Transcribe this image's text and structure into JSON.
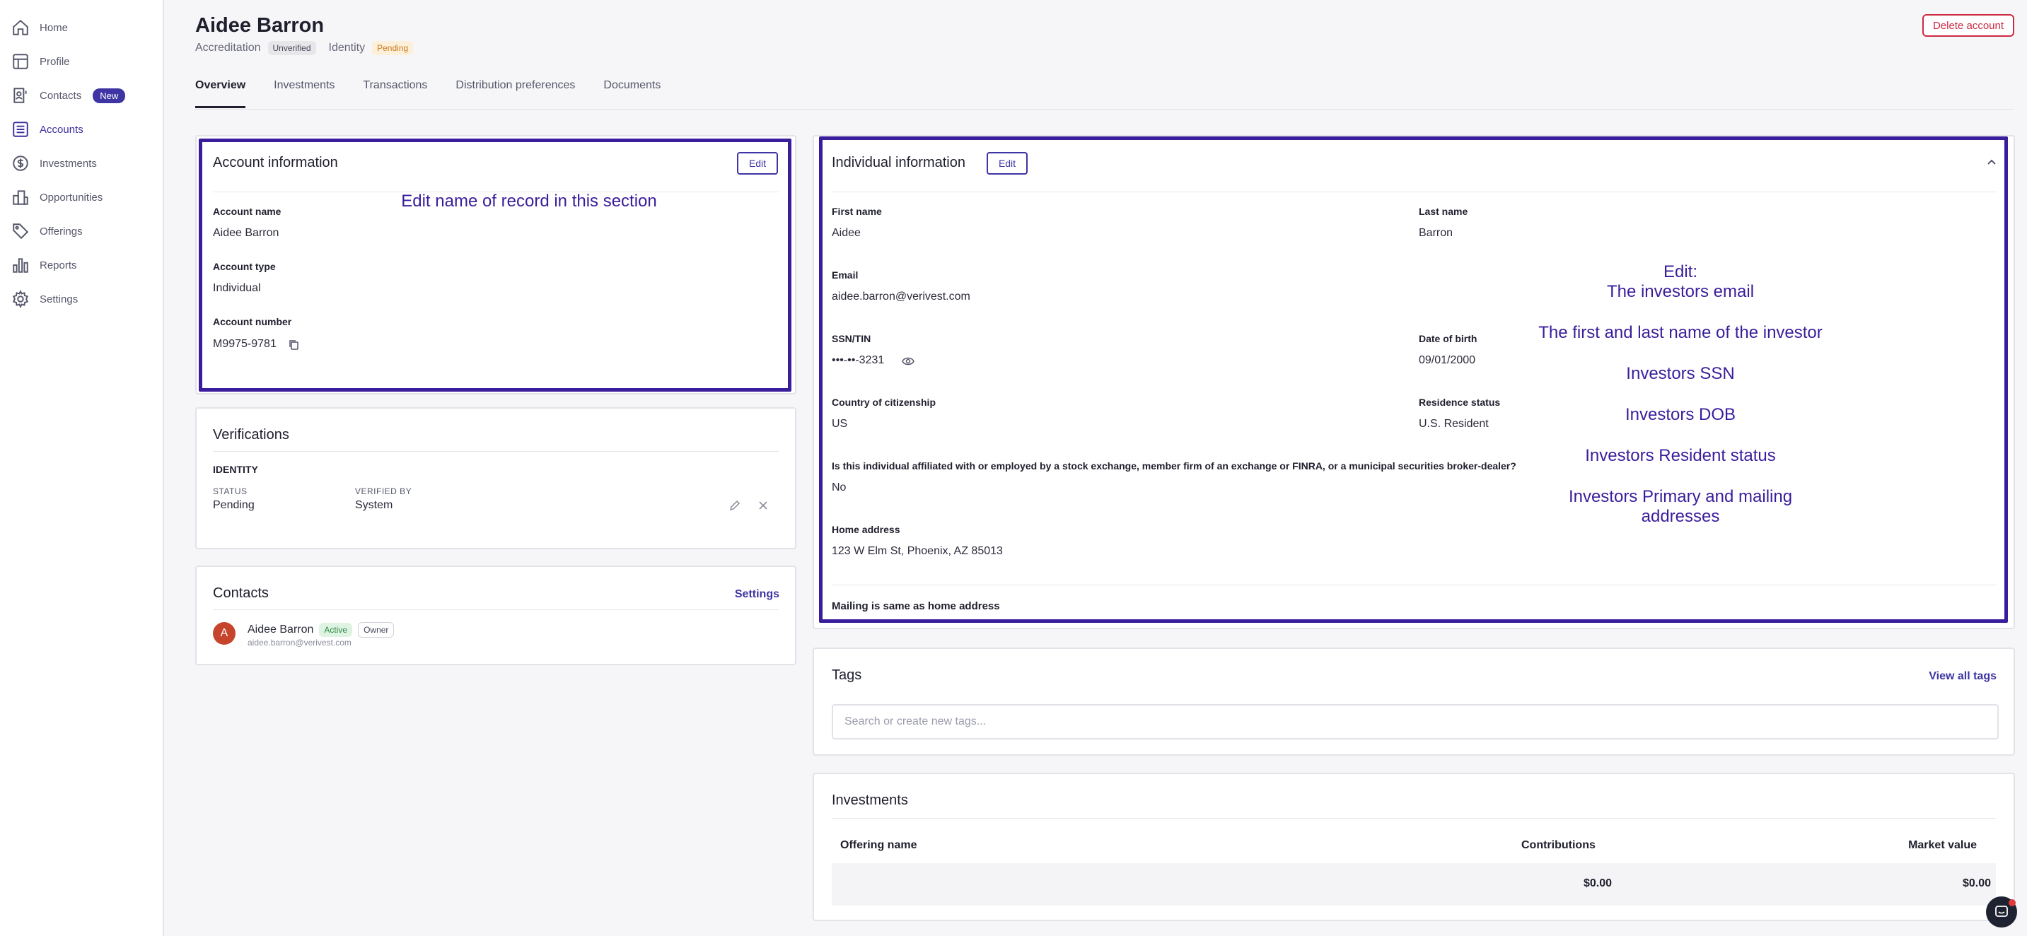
{
  "sidebar": {
    "items": [
      {
        "label": "Home",
        "icon": "home-icon"
      },
      {
        "label": "Profile",
        "icon": "profile-icon"
      },
      {
        "label": "Contacts",
        "icon": "contacts-icon",
        "badge": "New"
      },
      {
        "label": "Accounts",
        "icon": "accounts-icon",
        "active": true
      },
      {
        "label": "Investments",
        "icon": "dollar-icon"
      },
      {
        "label": "Opportunities",
        "icon": "building-icon"
      },
      {
        "label": "Offerings",
        "icon": "tag-icon"
      },
      {
        "label": "Reports",
        "icon": "bar-chart-icon"
      },
      {
        "label": "Settings",
        "icon": "gear-icon"
      }
    ]
  },
  "header": {
    "title": "Aidee Barron",
    "accreditation_label": "Accreditation",
    "accreditation_status": "Unverified",
    "identity_label": "Identity",
    "identity_status": "Pending",
    "delete_label": "Delete account"
  },
  "tabs": [
    "Overview",
    "Investments",
    "Transactions",
    "Distribution preferences",
    "Documents"
  ],
  "account_info": {
    "title": "Account information",
    "edit_label": "Edit",
    "annotation": "Edit name of record in this section",
    "fields": [
      {
        "label": "Account name",
        "value": "Aidee Barron"
      },
      {
        "label": "Account type",
        "value": "Individual"
      },
      {
        "label": "Account number",
        "value": "M9975-9781"
      }
    ]
  },
  "verifications": {
    "title": "Verifications",
    "section": "IDENTITY",
    "status_label": "STATUS",
    "status_value": "Pending",
    "verified_by_label": "VERIFIED BY",
    "verified_by_value": "System"
  },
  "contacts": {
    "title": "Contacts",
    "settings_label": "Settings",
    "items": [
      {
        "initial": "A",
        "name": "Aidee Barron",
        "status": "Active",
        "role": "Owner",
        "email": "aidee.barron@verivest.com"
      }
    ]
  },
  "individual_info": {
    "title": "Individual information",
    "edit_label": "Edit",
    "first_name_label": "First name",
    "first_name": "Aidee",
    "last_name_label": "Last name",
    "last_name": "Barron",
    "email_label": "Email",
    "email": "aidee.barron@verivest.com",
    "ssn_label": "SSN/TIN",
    "ssn": "•••-••-3231",
    "dob_label": "Date of birth",
    "dob": "09/01/2000",
    "citizenship_label": "Country of citizenship",
    "citizenship": "US",
    "residence_label": "Residence status",
    "residence": "U.S. Resident",
    "affiliation_label": "Is this individual affiliated with or employed by a stock exchange, member firm of an exchange or FINRA, or a municipal securities broker-dealer?",
    "affiliation": "No",
    "home_address_label": "Home address",
    "home_address": "123 W Elm St, Phoenix, AZ 85013",
    "mailing_note": "Mailing is same as home address",
    "annotations": [
      "Edit:",
      "The investors email",
      "The first and last name of the investor",
      "Investors SSN",
      "Investors DOB",
      "Investors Resident status",
      "Investors Primary and mailing",
      "addresses"
    ]
  },
  "tags": {
    "title": "Tags",
    "view_all_label": "View all tags",
    "placeholder": "Search or create new tags..."
  },
  "investments": {
    "title": "Investments",
    "columns": [
      "Offering name",
      "Contributions",
      "Market value"
    ],
    "rows": [
      {
        "offering": "",
        "contributions": "$0.00",
        "market_value": "$0.00"
      }
    ]
  },
  "colors": {
    "accent": "#3e34a4",
    "annotation": "#3a1d9c",
    "danger": "#cc2a42"
  }
}
